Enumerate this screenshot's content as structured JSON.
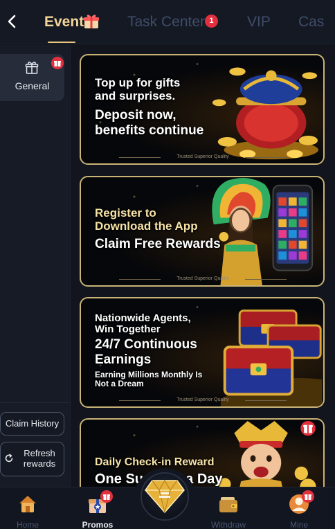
{
  "header": {
    "back_icon": "chevron-left-icon",
    "tabs": [
      {
        "label": "Event",
        "active": true,
        "icon": "gift-icon"
      },
      {
        "label": "Task Center",
        "badge": "1"
      },
      {
        "label": "VIP"
      },
      {
        "label": "Cas"
      }
    ]
  },
  "sidebar": {
    "items": [
      {
        "label": "General",
        "icon": "gift-outline-icon",
        "badge_icon": "gift-badge-icon",
        "selected": true
      }
    ],
    "claim_history_label": "Claim History",
    "refresh_rewards_label": "Refresh rewards",
    "refresh_icon": "refresh-icon"
  },
  "banners": [
    {
      "lines": [
        "Top up for gifts",
        "and surprises.",
        "Deposit now,",
        "benefits continue"
      ],
      "footer": "Trusted Superior Quality",
      "art": "treasure-pot-with-gold-ingots"
    },
    {
      "lines": [
        "Register to",
        "Download the App",
        "Claim Free Rewards"
      ],
      "footer": "Trusted Superior Quality",
      "art": "feathered-woman-with-phone"
    },
    {
      "lines": [
        "Nationwide Agents,",
        "Win Together",
        "24/7 Continuous",
        "Earnings",
        "Earning Millions Monthly Is",
        "Not a Dream"
      ],
      "footer": "Trusted Superior Quality",
      "art": "treasure-chests"
    },
    {
      "lines": [
        "Daily Check-in Reward",
        "One Surprise a Day"
      ],
      "art": "fortune-god-with-coins"
    }
  ],
  "bottom_nav": {
    "items": [
      {
        "label": "Home",
        "icon": "house-icon"
      },
      {
        "label": "Promos",
        "icon": "promo-gift-icon",
        "active": true,
        "badge_icon": "gift-badge-icon"
      },
      {
        "label": "Withdraw",
        "icon": "wallet-icon"
      },
      {
        "label": "Mine",
        "icon": "avatar-icon",
        "badge_icon": "gift-badge-icon"
      }
    ],
    "center_icon": "gold-diamond-icon"
  },
  "colors": {
    "background": "#12151d",
    "accent_gold": "#e9c980",
    "badge_red": "#e3303f",
    "inactive_text": "#3f4d69",
    "banner_border": "#c9b477"
  }
}
